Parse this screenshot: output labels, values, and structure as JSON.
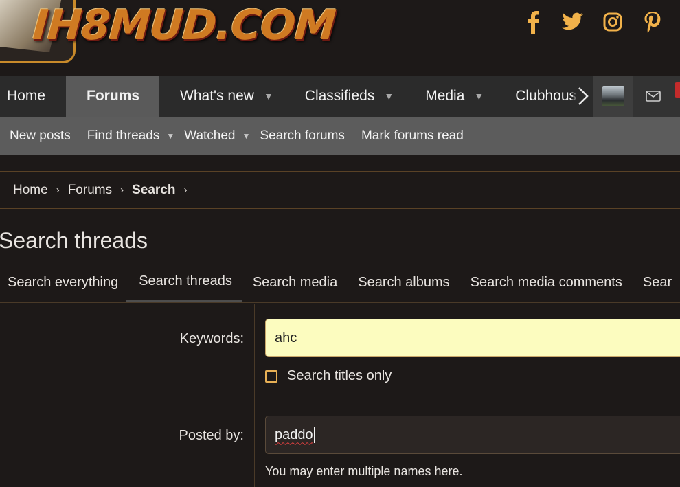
{
  "site": {
    "logo_text": "IH8MUD.COM"
  },
  "social": [
    {
      "name": "facebook-icon"
    },
    {
      "name": "twitter-icon"
    },
    {
      "name": "instagram-icon"
    },
    {
      "name": "pinterest-icon"
    }
  ],
  "nav": {
    "tabs": [
      {
        "label": "Home"
      },
      {
        "label": "Forums"
      },
      {
        "label": "What's new"
      },
      {
        "label": "Classifieds"
      },
      {
        "label": "Media"
      },
      {
        "label": "Clubhous"
      }
    ]
  },
  "subnav": {
    "items": [
      {
        "label": "New posts"
      },
      {
        "label": "Find threads"
      },
      {
        "label": "Watched"
      },
      {
        "label": "Search forums"
      },
      {
        "label": "Mark forums read"
      }
    ]
  },
  "breadcrumb": {
    "items": [
      "Home",
      "Forums",
      "Search"
    ]
  },
  "page": {
    "title": "Search threads"
  },
  "search_tabs": [
    {
      "label": "Search everything"
    },
    {
      "label": "Search threads"
    },
    {
      "label": "Search media"
    },
    {
      "label": "Search albums"
    },
    {
      "label": "Search media comments"
    },
    {
      "label": "Sear"
    }
  ],
  "form": {
    "keywords_label": "Keywords:",
    "keywords_value": "ahc",
    "titles_only_label": "Search titles only",
    "posted_by_label": "Posted by:",
    "posted_by_value": "paddo",
    "posted_by_hint": "You may enter multiple names here."
  },
  "colors": {
    "accent": "#f2b24a",
    "page_bg": "#1d1918",
    "keywords_bg": "#fcfcbf"
  }
}
